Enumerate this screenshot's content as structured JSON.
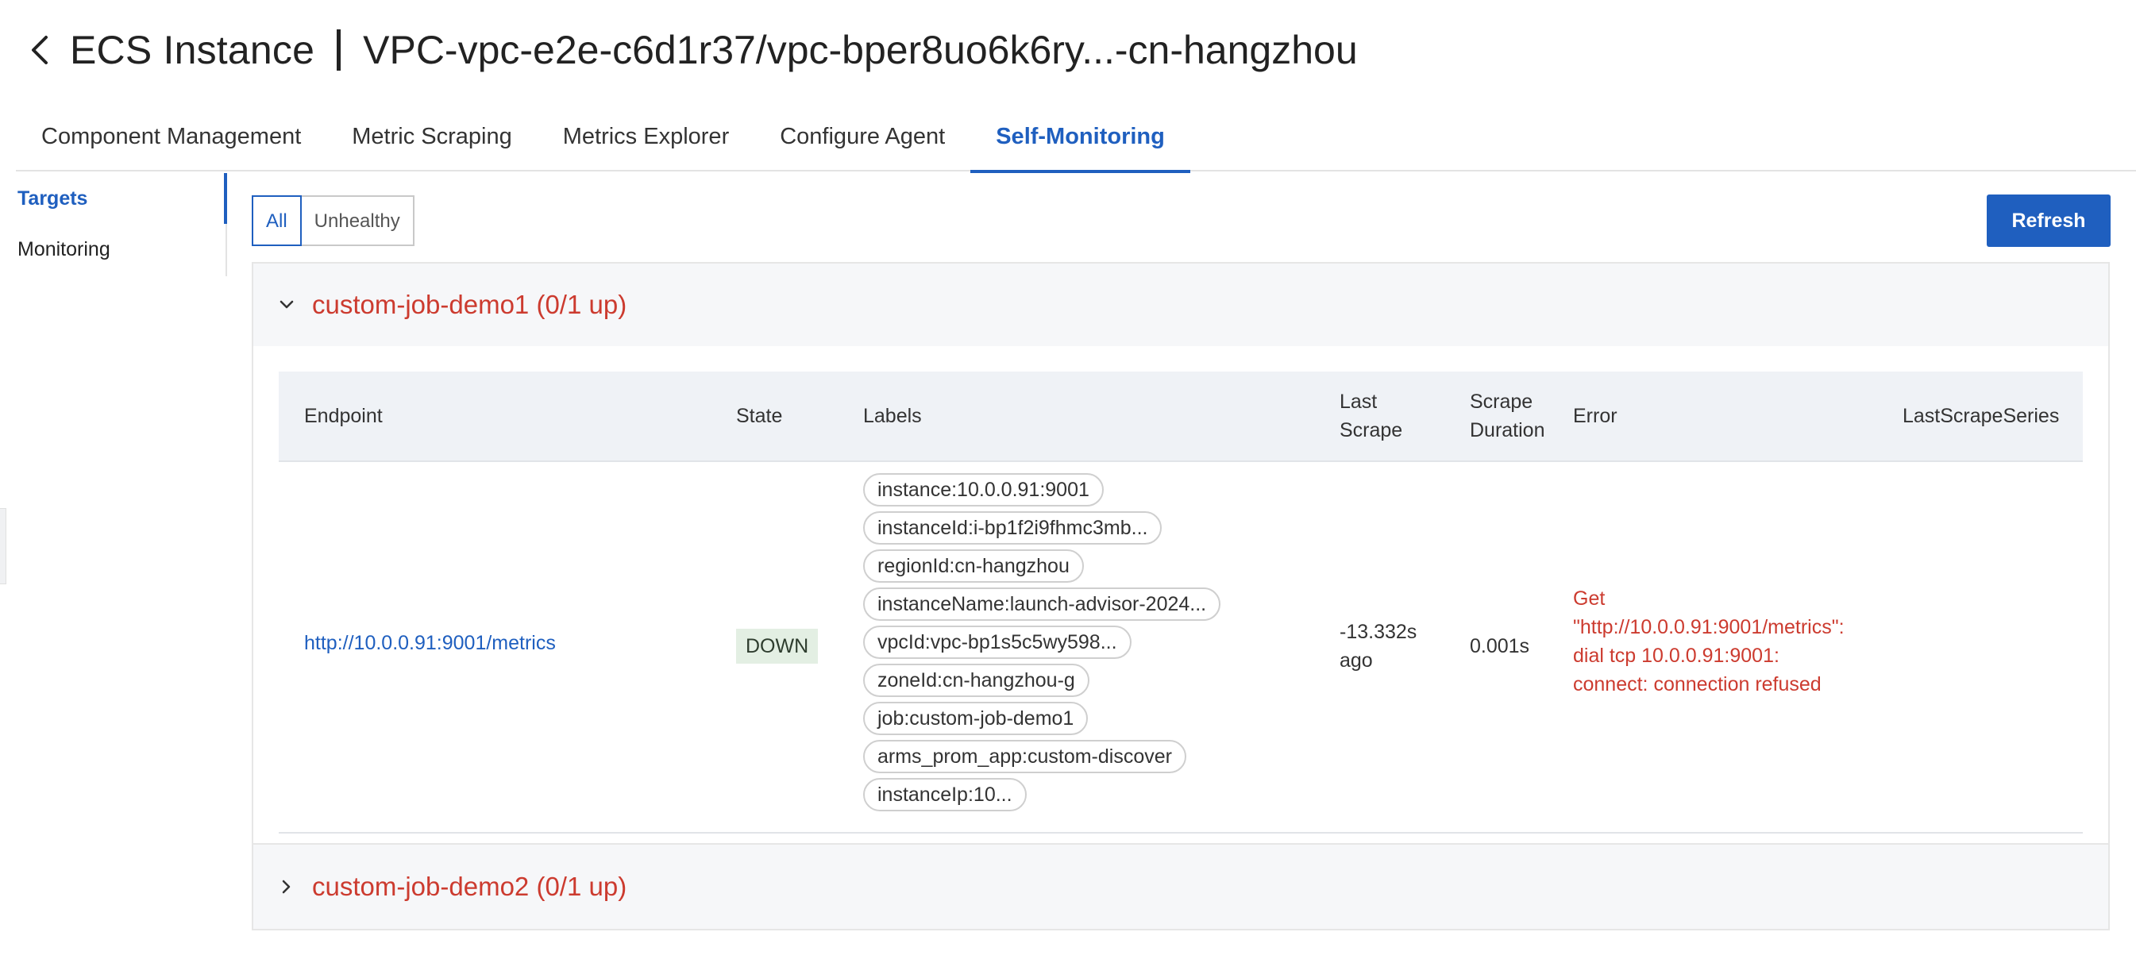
{
  "header": {
    "title": "ECS Instance",
    "subtitle": "VPC-vpc-e2e-c6d1r37/vpc-bper8uo6k6ry...-cn-hangzhou"
  },
  "tabs": [
    {
      "label": "Component Management",
      "active": false
    },
    {
      "label": "Metric Scraping",
      "active": false
    },
    {
      "label": "Metrics Explorer",
      "active": false
    },
    {
      "label": "Configure Agent",
      "active": false
    },
    {
      "label": "Self-Monitoring",
      "active": true
    }
  ],
  "sidebar": {
    "items": [
      {
        "label": "Targets",
        "active": true
      },
      {
        "label": "Monitoring",
        "active": false
      }
    ]
  },
  "filter": {
    "all_label": "All",
    "unhealthy_label": "Unhealthy"
  },
  "refresh_label": "Refresh",
  "jobs": [
    {
      "title": "custom-job-demo1 (0/1 up)",
      "expanded": true,
      "columns": {
        "endpoint": "Endpoint",
        "state": "State",
        "labels": "Labels",
        "last_scrape_1": "Last",
        "last_scrape_2": "Scrape",
        "scrape_duration_1": "Scrape",
        "scrape_duration_2": "Duration",
        "error": "Error",
        "last_scrape_series": "LastScrapeSeries"
      },
      "row": {
        "endpoint": "http://10.0.0.91:9001/metrics",
        "state": "DOWN",
        "labels": [
          "instance:10.0.0.91:9001",
          "instanceId:i-bp1f2i9fhmc3mb...",
          "regionId:cn-hangzhou",
          "instanceName:launch-advisor-2024...",
          "vpcId:vpc-bp1s5c5wy598...",
          "zoneId:cn-hangzhou-g",
          "job:custom-job-demo1",
          "arms_prom_app:custom-discover",
          "instanceIp:10..."
        ],
        "last_scrape_1": "-13.332s",
        "last_scrape_2": "ago",
        "scrape_duration": "0.001s",
        "error_lines": [
          "Get",
          "\"http://10.0.0.91:9001/metrics\":",
          "dial tcp 10.0.0.91:9001:",
          "connect: connection refused"
        ]
      }
    },
    {
      "title": "custom-job-demo2 (0/1 up)",
      "expanded": false
    }
  ],
  "colors": {
    "accent": "#1f5fbf",
    "error": "#cc3b2f",
    "down_badge_bg": "#e3efe3"
  },
  "icons": [
    "back-arrow-icon",
    "chevron-down-icon",
    "chevron-right-icon"
  ]
}
